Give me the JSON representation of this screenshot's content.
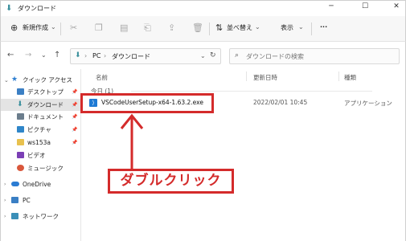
{
  "window": {
    "title": "ダウンロード",
    "controls": {
      "minimize": "─",
      "maximize": "☐",
      "close": "✕"
    }
  },
  "toolbar": {
    "new_label": "新規作成",
    "new_chevron": "⌄",
    "sort_label": "並べ替え",
    "sort_chevron": "⌄",
    "view_label": "表示",
    "view_chevron": "⌄",
    "more_label": "···"
  },
  "navigation": {
    "back": "←",
    "forward": "→",
    "recent": "⌄",
    "up": "↑",
    "breadcrumb": [
      "PC",
      "ダウンロード"
    ],
    "separator": "›",
    "chevron": "⌄",
    "refresh": "↻",
    "search_placeholder": "ダウンロードの検索"
  },
  "sidebar": {
    "quick_access": "クイック アクセス",
    "items": [
      {
        "label": "デスクトップ",
        "icon": "desktop-icon",
        "color": "#3b7fc4"
      },
      {
        "label": "ダウンロード",
        "icon": "download-icon",
        "color": "#3a8f9c"
      },
      {
        "label": "ドキュメント",
        "icon": "documents-icon",
        "color": "#6b7d8c"
      },
      {
        "label": "ピクチャ",
        "icon": "pictures-icon",
        "color": "#2f86c9"
      },
      {
        "label": "ws153a",
        "icon": "folder-icon",
        "color": "#e8c14e"
      },
      {
        "label": "ビデオ",
        "icon": "videos-icon",
        "color": "#7b3fb5"
      },
      {
        "label": "ミュージック",
        "icon": "music-icon",
        "color": "#d9573b"
      }
    ],
    "onedrive": "OneDrive",
    "pc": "PC",
    "network": "ネットワーク"
  },
  "columns": {
    "name": "名前",
    "modified": "更新日時",
    "type": "種類"
  },
  "group_label": "今日 (1)",
  "files": [
    {
      "name": "VSCodeUserSetup-x64-1.63.2.exe",
      "modified": "2022/02/01 10:45",
      "type": "アプリケーション"
    }
  ],
  "annotation": {
    "callout": "ダブルクリック",
    "color": "#d42b2b"
  }
}
